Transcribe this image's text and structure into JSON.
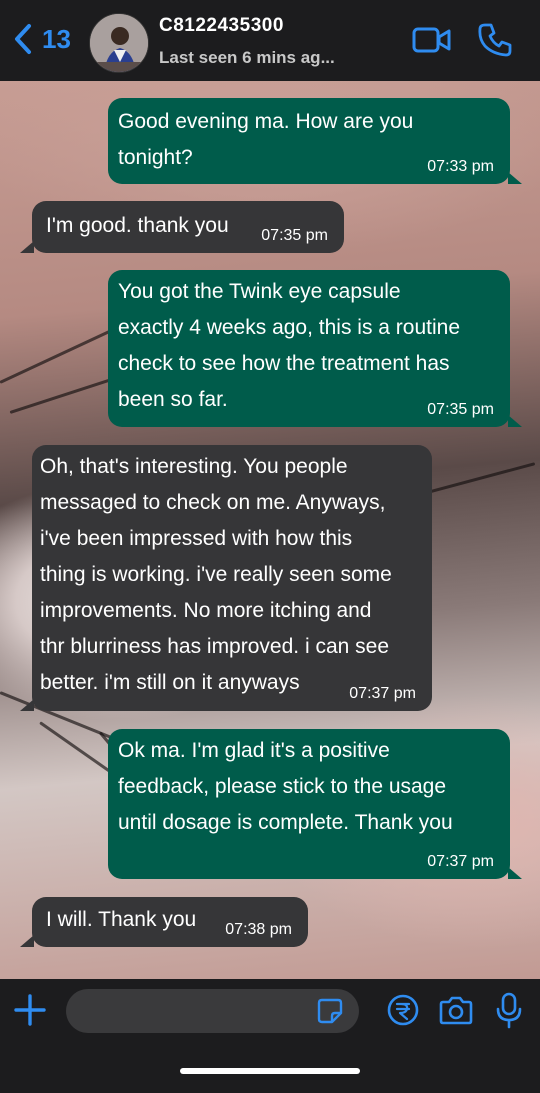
{
  "header": {
    "back_count": "13",
    "contact_name": "C8122435300",
    "status": "Last seen 6 mins ag..."
  },
  "messages": [
    {
      "direction": "out",
      "text": " Good evening ma. How are you\ntonight?",
      "time": "07:33 pm"
    },
    {
      "direction": "in",
      "text": "I'm good. thank you",
      "time": "07:35 pm"
    },
    {
      "direction": "out",
      "text": " You got the Twink eye capsule\nexactly 4 weeks ago, this is a routine\ncheck to see how the treatment has\nbeen so far.",
      "time": "07:35 pm"
    },
    {
      "direction": "in",
      "text": " Oh, that's interesting. You people\nmessaged to check on me. Anyways,\ni've been impressed with how this\nthing is working. i've really seen some\nimprovements. No more itching and\nthr blurriness has improved. i can see\nbetter. i'm still on it anyways",
      "time": "07:37 pm"
    },
    {
      "direction": "out",
      "text": " Ok ma. I'm glad it's a positive\nfeedback, please stick to the usage\nuntil dosage is complete. Thank you",
      "time": "07:37 pm"
    },
    {
      "direction": "in",
      "text": "I will. Thank you",
      "time": "07:38 pm"
    }
  ],
  "composer": {
    "placeholder": ""
  },
  "colors": {
    "accent": "#2f8cf0",
    "outgoing_bubble": "#005c4b",
    "incoming_bubble": "#363638",
    "bar": "#1c1c1e"
  },
  "icons": [
    "chevron-left-icon",
    "video-call-icon",
    "phone-icon",
    "plus-icon",
    "sticker-icon",
    "payment-icon",
    "camera-icon",
    "microphone-icon"
  ]
}
